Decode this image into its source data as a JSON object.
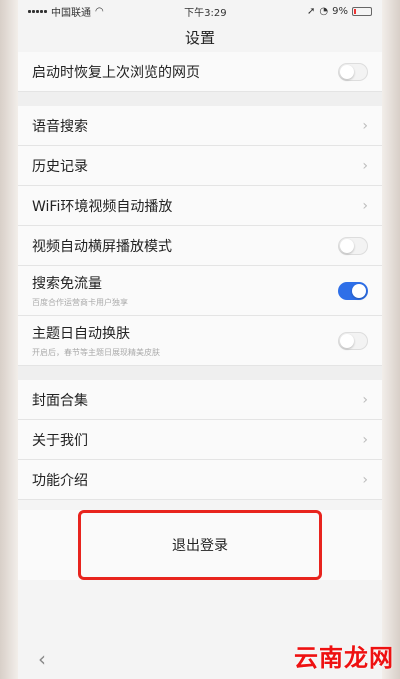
{
  "status": {
    "carrier": "中国联通",
    "time": "下午3:29",
    "battery": "9%"
  },
  "header": {
    "title": "设置"
  },
  "settings": {
    "rows": [
      {
        "label": "启动时恢复上次浏览的网页",
        "sub": "",
        "control": "toggle",
        "on": false
      },
      {
        "label": "语音搜索",
        "sub": "",
        "control": "chevron"
      },
      {
        "label": "历史记录",
        "sub": "",
        "control": "chevron"
      },
      {
        "label": "WiFi环境视频自动播放",
        "sub": "",
        "control": "chevron"
      },
      {
        "label": "视频自动横屏播放模式",
        "sub": "",
        "control": "toggle",
        "on": false
      },
      {
        "label": "搜索免流量",
        "sub": "百度合作运营商卡用户独享",
        "control": "toggle",
        "on": true
      },
      {
        "label": "主题日自动换肤",
        "sub": "开启后，春节等主题日展现精美皮肤",
        "control": "toggle",
        "on": false
      }
    ],
    "rows2": [
      {
        "label": "封面合集",
        "control": "chevron"
      },
      {
        "label": "关于我们",
        "control": "chevron"
      },
      {
        "label": "功能介绍",
        "control": "chevron"
      }
    ]
  },
  "logout": {
    "label": "退出登录"
  },
  "nav": {
    "back_icon": "chevron-left-icon"
  },
  "watermark": {
    "text": "云南龙网"
  },
  "colors": {
    "toggle_on": "#2e6fe8",
    "highlight": "#e8241e",
    "watermark": "#ee1111"
  }
}
